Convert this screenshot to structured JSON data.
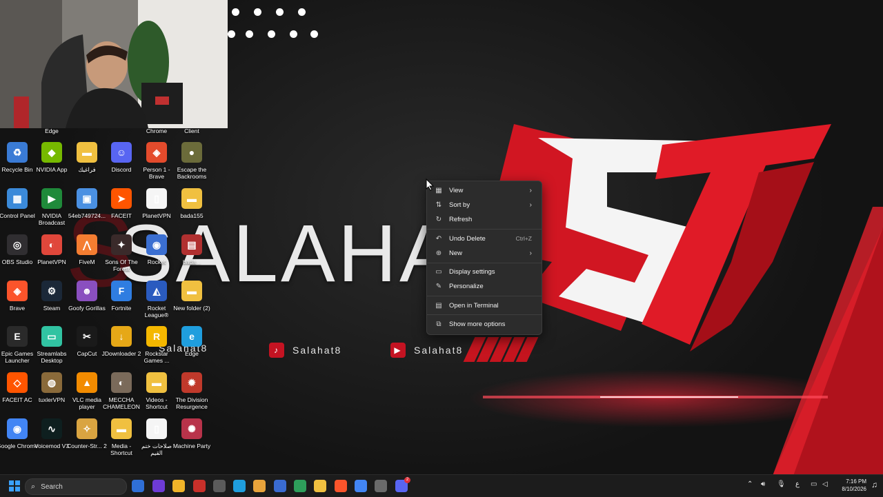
{
  "desktop": {
    "wall_title": "SALAHA",
    "social": [
      {
        "handle": "Salahat8",
        "icon": "tiktok-icon"
      },
      {
        "handle": "Salahat8",
        "icon": "youtube-icon"
      },
      {
        "handle": "Salahat8",
        "icon": "kick-icon"
      }
    ],
    "top_partial_labels": [
      "Edge",
      "Chrome",
      "Client"
    ],
    "icons": [
      {
        "label": "Recycle Bin",
        "color": "#3a7bd5",
        "glyph": "♻"
      },
      {
        "label": "NVIDIA App",
        "color": "#76b900",
        "glyph": "◆"
      },
      {
        "label": "فراغيك",
        "color": "#f0c040",
        "glyph": "▬"
      },
      {
        "label": "Discord",
        "color": "#5865f2",
        "glyph": "☺"
      },
      {
        "label": "Person 1 - Brave",
        "color": "#e44b2c",
        "glyph": "◈"
      },
      {
        "label": "Escape the Backrooms",
        "color": "#6b6b3a",
        "glyph": "●"
      },
      {
        "label": "Control Panel",
        "color": "#3b8ad9",
        "glyph": "▦"
      },
      {
        "label": "NVIDIA Broadcast",
        "color": "#1f8a3a",
        "glyph": "▶"
      },
      {
        "label": "54eb749724...",
        "color": "#4a90e2",
        "glyph": "▣"
      },
      {
        "label": "FACEIT",
        "color": "#ff5500",
        "glyph": "➤"
      },
      {
        "label": "PlanetVPN",
        "color": "#f5f5f5",
        "glyph": "▯"
      },
      {
        "label": "bada155",
        "color": "#f0c040",
        "glyph": "▬"
      },
      {
        "label": "OBS Studio",
        "color": "#302e31",
        "glyph": "◎"
      },
      {
        "label": "PlanetVPN",
        "color": "#e0473b",
        "glyph": "◐"
      },
      {
        "label": "FiveM",
        "color": "#f47d31",
        "glyph": "⋀"
      },
      {
        "label": "Sons Of The Forest",
        "color": "#3a2a2a",
        "glyph": "✦"
      },
      {
        "label": "Rocket",
        "color": "#3b6fd1",
        "glyph": "◉"
      },
      {
        "label": "bada...",
        "color": "#b03030",
        "glyph": "▤"
      },
      {
        "label": "Brave",
        "color": "#fb542b",
        "glyph": "◈"
      },
      {
        "label": "Steam",
        "color": "#1b2838",
        "glyph": "⚙"
      },
      {
        "label": "Goofy Gorillas",
        "color": "#8a4fbf",
        "glyph": "☻"
      },
      {
        "label": "Fortnite",
        "color": "#2f7de1",
        "glyph": "F"
      },
      {
        "label": "Rocket League®",
        "color": "#2a5bbf",
        "glyph": "◭"
      },
      {
        "label": "New folder (2)",
        "color": "#f0c040",
        "glyph": "▬"
      },
      {
        "label": "Epic Games Launcher",
        "color": "#2a2a2a",
        "glyph": "E"
      },
      {
        "label": "Streamlabs Desktop",
        "color": "#31c3a2",
        "glyph": "▭"
      },
      {
        "label": "CapCut",
        "color": "#1a1a1a",
        "glyph": "✂"
      },
      {
        "label": "JDownloader 2",
        "color": "#e6a817",
        "glyph": "↓"
      },
      {
        "label": "Rockstar Games ...",
        "color": "#f5b800",
        "glyph": "R"
      },
      {
        "label": "Edge",
        "color": "#1f9ede",
        "glyph": "e"
      },
      {
        "label": "FACEIT AC",
        "color": "#ff5500",
        "glyph": "◇"
      },
      {
        "label": "tuxlerVPN",
        "color": "#8a6a3a",
        "glyph": "◍"
      },
      {
        "label": "VLC media player",
        "color": "#f28b00",
        "glyph": "▲"
      },
      {
        "label": "MECCHA CHAMELEON",
        "color": "#7a6a5a",
        "glyph": "◐"
      },
      {
        "label": "Videos - Shortcut",
        "color": "#f0c040",
        "glyph": "▬"
      },
      {
        "label": "The Division Resurgence",
        "color": "#c0392b",
        "glyph": "✹"
      },
      {
        "label": "Google Chrome",
        "color": "#4285f4",
        "glyph": "◉"
      },
      {
        "label": "Voicemod V3",
        "color": "#0e1f1f",
        "glyph": "∿"
      },
      {
        "label": "Counter-Str... 2",
        "color": "#d9a441",
        "glyph": "✧"
      },
      {
        "label": "Media - Shortcut",
        "color": "#f0c040",
        "glyph": "▬"
      },
      {
        "label": "صلاحات ختم القيم",
        "color": "#f5f5f5",
        "glyph": "▯"
      },
      {
        "label": "Machine Party",
        "color": "#b8334a",
        "glyph": "✺"
      }
    ]
  },
  "context_menu": {
    "items": [
      {
        "label": "View",
        "icon": "grid-icon",
        "arrow": true
      },
      {
        "label": "Sort by",
        "icon": "sort-icon",
        "arrow": true
      },
      {
        "label": "Refresh",
        "icon": "refresh-icon"
      },
      {
        "label": "Undo Delete",
        "icon": "undo-icon",
        "shortcut": "Ctrl+Z"
      },
      {
        "label": "New",
        "icon": "plus-circle-icon",
        "arrow": true
      },
      {
        "label": "Display settings",
        "icon": "display-icon"
      },
      {
        "label": "Personalize",
        "icon": "pen-icon"
      },
      {
        "label": "Open in Terminal",
        "icon": "terminal-icon"
      },
      {
        "label": "Show more options",
        "icon": "more-options-icon"
      }
    ]
  },
  "taskbar": {
    "search_placeholder": "Search",
    "apps": [
      {
        "name": "widget-app",
        "color": "#2f6fd6"
      },
      {
        "name": "copilot",
        "color": "#6e3bd6"
      },
      {
        "name": "emoji-app",
        "color": "#f0b429"
      },
      {
        "name": "news-app",
        "color": "#c8302a"
      },
      {
        "name": "store",
        "color": "#5b5b5b"
      },
      {
        "name": "edge",
        "color": "#1f9ede"
      },
      {
        "name": "chrome",
        "color": "#e8a33b"
      },
      {
        "name": "app-blue",
        "color": "#3a6bd1"
      },
      {
        "name": "app-green",
        "color": "#2e9e5b"
      },
      {
        "name": "file-explorer",
        "color": "#f0c040"
      },
      {
        "name": "brave",
        "color": "#fb542b"
      },
      {
        "name": "chrome-2",
        "color": "#4285f4"
      },
      {
        "name": "settings",
        "color": "#6a6a6a"
      },
      {
        "name": "discord",
        "color": "#5865f2"
      }
    ],
    "discord_badge": "2",
    "tray_lang": "ع",
    "time": "7:16 PM",
    "date": "8/10/2026"
  }
}
